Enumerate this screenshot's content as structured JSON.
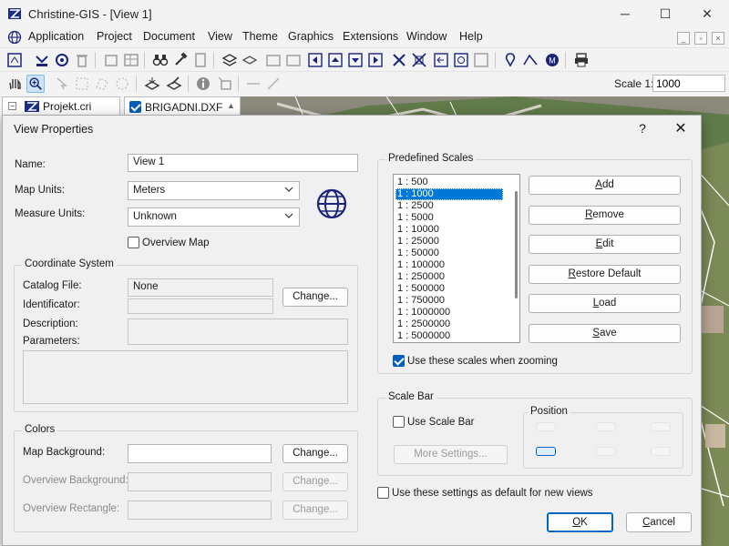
{
  "window": {
    "title": "Christine-GIS - [View 1]",
    "minimize": "─",
    "maximize": "☐",
    "close": "✕"
  },
  "menu": {
    "items": [
      "Application",
      "Project",
      "Document",
      "View",
      "Theme",
      "Graphics",
      "Extensions",
      "Window",
      "Help"
    ]
  },
  "toolbar": {
    "scale_label": "Scale 1:",
    "scale_value": "1000"
  },
  "project_panel": {
    "title": "Projekt.cri"
  },
  "document_tab": {
    "title": "BRIGADNI.DXF"
  },
  "dialog": {
    "title": "View Properties",
    "help": "?",
    "close": "✕",
    "name_label": "Name:",
    "name_value": "View 1",
    "map_units_label": "Map Units:",
    "map_units_value": "Meters",
    "measure_units_label": "Measure Units:",
    "measure_units_value": "Unknown",
    "overview_map_label": "Overview Map",
    "overview_map_checked": false,
    "coordinate_system": {
      "title": "Coordinate System",
      "catalog_file_label": "Catalog File:",
      "catalog_file_value": "None",
      "identificator_label": "Identificator:",
      "description_label": "Description:",
      "parameters_label": "Parameters:",
      "change_label": "Change..."
    },
    "colors": {
      "title": "Colors",
      "map_background_label": "Map Background:",
      "overview_background_label": "Overview Background:",
      "overview_rectangle_label": "Overview Rectangle:",
      "change_label": "Change..."
    },
    "predefined_scales": {
      "title": "Predefined Scales",
      "items": [
        "1 : 500",
        "1 : 1000",
        "1 : 2500",
        "1 : 5000",
        "1 : 10000",
        "1 : 25000",
        "1 : 50000",
        "1 : 100000",
        "1 : 250000",
        "1 : 500000",
        "1 : 750000",
        "1 : 1000000",
        "1 : 2500000",
        "1 : 5000000"
      ],
      "selected": "1 : 1000",
      "add_label": "Add",
      "remove_label": "Remove",
      "edit_label": "Edit",
      "restore_label": "Restore Default",
      "load_label": "Load",
      "save_label": "Save",
      "use_scales_label": "Use these scales when zooming",
      "use_scales_checked": true
    },
    "scale_bar": {
      "title": "Scale Bar",
      "use_label": "Use Scale Bar",
      "use_checked": false,
      "more_settings_label": "More Settings...",
      "position_title": "Position",
      "position_selected": "bottom-left"
    },
    "default_label": "Use these settings as default for new views",
    "default_checked": false,
    "ok_label": "OK",
    "cancel_label": "Cancel"
  },
  "colors": {
    "accent": "#005fb8",
    "selection": "#0078d7",
    "map_green": "#5f7a4c"
  }
}
